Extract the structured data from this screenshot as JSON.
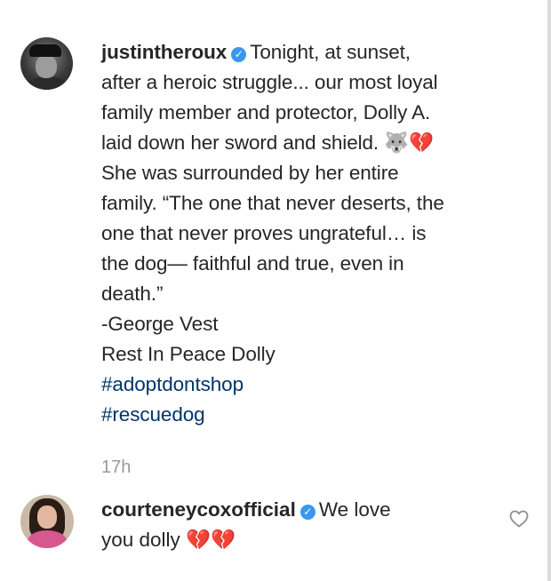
{
  "post": {
    "author": "justintheroux",
    "lines": [
      "Tonight, at sunset,",
      "after a heroic struggle... our most loyal",
      "family member and protector, Dolly A.",
      "laid down her sword and shield.",
      "She was surrounded by her entire",
      "family. “The one that never deserts, the",
      "one that never proves ungrateful… is",
      "the dog— faithful and true, even in",
      "death.”",
      "-George Vest",
      "Rest In Peace Dolly"
    ],
    "emoji_wolf": "🐺",
    "emoji_broken_heart": "💔",
    "hashtags": [
      "#adoptdontshop",
      "#rescuedog"
    ],
    "time_ago": "17h"
  },
  "comment": {
    "author": "courteneycoxofficial",
    "text_line1": "We love",
    "text_line2": "you dolly",
    "emoji": "💔💔"
  },
  "colors": {
    "text": "#262626",
    "hashtag": "#003569",
    "verified": "#3897f0",
    "timestamp": "#999999"
  },
  "icons": {
    "verified": "verified-badge-icon",
    "like": "heart-outline-icon"
  }
}
